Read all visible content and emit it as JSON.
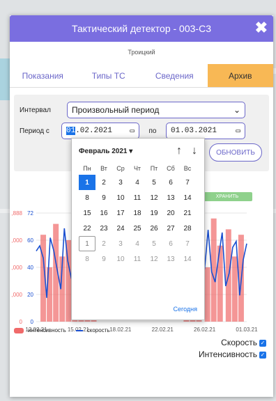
{
  "window": {
    "title": "Тактический детектор - 003-C3",
    "close_label": "✖",
    "subtitle": "Троицкий"
  },
  "tabs": [
    {
      "label": "Показания",
      "active": false
    },
    {
      "label": "Типы ТС",
      "active": false
    },
    {
      "label": "Сведения",
      "active": false
    },
    {
      "label": "Архив",
      "active": true
    }
  ],
  "filters": {
    "interval_label": "Интервал",
    "interval_value": "Произвольный период",
    "period_label": "Период с",
    "date_from_highlight": "01",
    "date_from_rest": ".02.2021",
    "to_label": "по",
    "date_to": "01.03.2021",
    "refresh_label": "ОБНОВИТЬ"
  },
  "datepicker": {
    "month_label": "Февраль 2021 ▾",
    "weekdays": [
      "Пн",
      "Вт",
      "Ср",
      "Чт",
      "Пт",
      "Сб",
      "Вс"
    ],
    "days": [
      [
        "1",
        "2",
        "3",
        "4",
        "5",
        "6",
        "7"
      ],
      [
        "8",
        "9",
        "10",
        "11",
        "12",
        "13",
        "14"
      ],
      [
        "15",
        "16",
        "17",
        "18",
        "19",
        "20",
        "21"
      ],
      [
        "22",
        "23",
        "24",
        "25",
        "26",
        "27",
        "28"
      ],
      [
        "1",
        "2",
        "3",
        "4",
        "5",
        "6",
        "7"
      ],
      [
        "8",
        "9",
        "10",
        "11",
        "12",
        "13",
        "14"
      ]
    ],
    "today_label": "Сегодня"
  },
  "chart_data": {
    "type": "line",
    "save_label": "ХРАНИТЬ",
    "x_ticks": [
      "12.02.21",
      "15.02.21",
      "18.02.21",
      "22.02.21",
      "26.02.21",
      "01.03.21"
    ],
    "y_left_ticks": [
      "0",
      "20",
      "40",
      "60",
      "72"
    ],
    "y_right_ticks": [
      "0",
      ",000",
      ",000",
      ",000",
      ",888"
    ],
    "series": [
      {
        "name": "интенсивность",
        "color": "#f06a6a"
      },
      {
        "name": "скорость",
        "color": "#1a4fd0"
      }
    ]
  },
  "legend": {
    "intensity_label": "интенсивность",
    "speed_label": "скорость"
  },
  "checks": {
    "speed_label": "Скорость",
    "intensity_label": "Интенсивность",
    "checkmark": "✓"
  }
}
